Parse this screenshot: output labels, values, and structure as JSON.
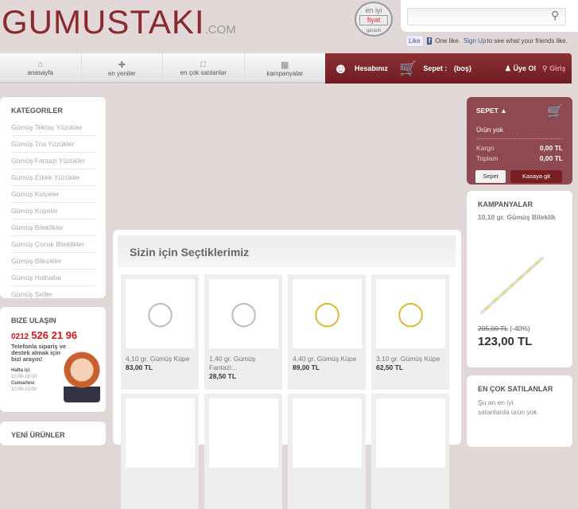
{
  "header": {
    "logo": "GUMUSTAKI",
    "logo_suffix": ".COM",
    "logo_reg": "®",
    "badge_top": "en iyi",
    "badge_mid": "fiyat",
    "badge_bot": "garanti",
    "search_placeholder": "",
    "fb_like": "Like",
    "fb_text": "One like.",
    "fb_signup": "Sign Up",
    "fb_rest": "to see what your friends like."
  },
  "nav": [
    {
      "label": "anasayfa",
      "icon": "home-icon"
    },
    {
      "label": "en yeniler",
      "icon": "plus-icon"
    },
    {
      "label": "en çok satılanlar",
      "icon": "chart-icon"
    },
    {
      "label": "kampanyalar",
      "icon": "gift-icon"
    }
  ],
  "account": {
    "account": "Hesabınız",
    "cart_label": "Sepet :",
    "cart_value": "(boş)",
    "register": "Üye Ol",
    "login": "Giriş"
  },
  "categories": {
    "title": "KATEGORILER",
    "items": [
      "Gümüş Tektaş Yüzükler",
      "Gümüş Tria Yüzükler",
      "Gümüş Fantazi Yüzükler",
      "Gümüş Erkek Yüzükler",
      "Gümüş Kolyeler",
      "Gümüş Küpeler",
      "Gümüş Bileklikler",
      "Gümüş Çocuk Bileklikler",
      "Gümüş Bilezikler",
      "Gümüş Halhallar",
      "Gümüş Setler"
    ]
  },
  "contact": {
    "title": "BIZE ULAŞIN",
    "phone_prefix": "0212",
    "phone": "526 21 96",
    "text": "Telefonla sipariş ve destek almak için bizi arayın!",
    "weekday": "Hafta içi",
    "weekday_hours": "10:00-18:00",
    "saturday": "Cumartesi",
    "saturday_hours": "10:00-15:00"
  },
  "new_products": {
    "title": "YENİ ÜRÜNLER"
  },
  "featured": {
    "title": "Sizin için Seçtiklerimiz",
    "products": [
      {
        "name": "4,10 gr. Gümüş Küpe",
        "price": "83,00 TL"
      },
      {
        "name": "1,40 gr. Gümüş Fantazi...",
        "price": "28,50 TL"
      },
      {
        "name": "4,40 gr. Gümüş Küpe",
        "price": "89,00 TL"
      },
      {
        "name": "3,10 gr. Gümüş Küpe",
        "price": "62,50 TL"
      }
    ]
  },
  "cart": {
    "title": "SEPET",
    "empty": "Ürün yok",
    "shipping_label": "Kargo",
    "shipping": "0,00 TL",
    "total_label": "Toplam",
    "total": "0,00 TL",
    "cart_button": "Sepet",
    "checkout_button": "Kasaya git"
  },
  "campaigns": {
    "title": "KAMPANYALAR",
    "product": "10,10 gr. Gümüş Bileklik",
    "old_price": "205,00 TL",
    "discount": "(-40%)",
    "price": "123,00 TL"
  },
  "bestsellers": {
    "title": "EN ÇOK SATILANLAR",
    "text": "Şu an en iyi satanlarda ürün yok"
  }
}
